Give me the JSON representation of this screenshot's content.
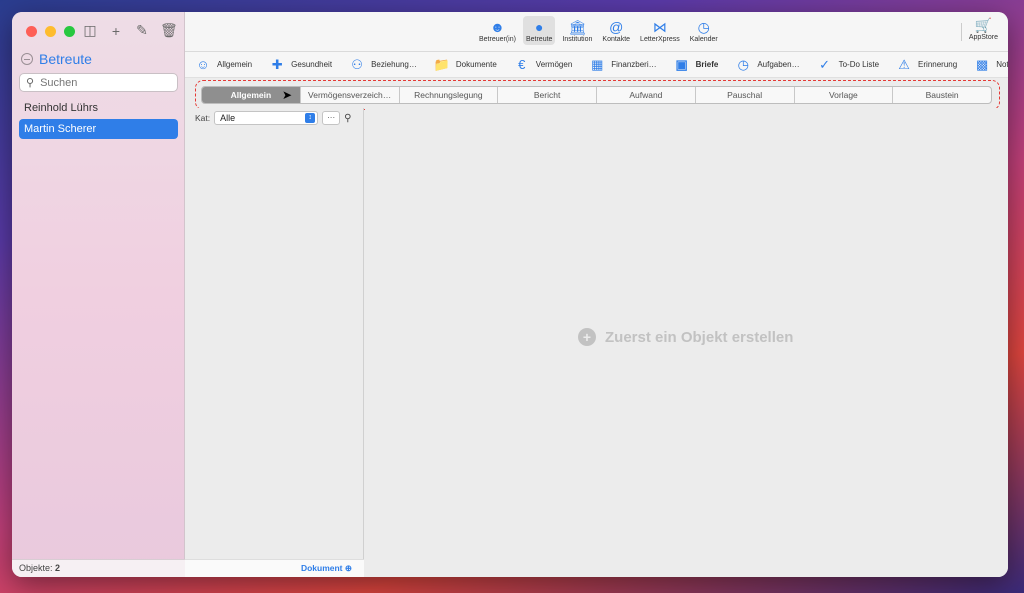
{
  "sidebar": {
    "section_title": "Betreute",
    "search_placeholder": "Suchen",
    "items": [
      {
        "label": "Reinhold Lührs"
      },
      {
        "label": "Martin Scherer"
      }
    ],
    "footer_label": "Objekte:",
    "footer_count": "2"
  },
  "toolbar": {
    "buttons": [
      {
        "label": "Betreuer(in)",
        "icon": "person-outline-icon"
      },
      {
        "label": "Betreute",
        "icon": "person-filled-icon"
      },
      {
        "label": "Institution",
        "icon": "bank-icon"
      },
      {
        "label": "Kontakte",
        "icon": "at-book-icon"
      },
      {
        "label": "LetterXpress",
        "icon": "letterxpress-icon"
      },
      {
        "label": "Kalender",
        "icon": "alarm-clock-icon"
      }
    ],
    "appstore_label": "AppStore"
  },
  "categories": [
    {
      "label": "Allgemein",
      "icon": "person-icon"
    },
    {
      "label": "Gesundheit",
      "icon": "medical-case-icon"
    },
    {
      "label": "Beziehung…",
      "icon": "people-icon"
    },
    {
      "label": "Dokumente",
      "icon": "folder-icon"
    },
    {
      "label": "Vermögen",
      "icon": "euro-icon"
    },
    {
      "label": "Finanzberi…",
      "icon": "chart-icon"
    },
    {
      "label": "Briefe",
      "icon": "document-icon"
    },
    {
      "label": "Aufgaben…",
      "icon": "task-icon"
    },
    {
      "label": "To-Do Liste",
      "icon": "checkmark-icon"
    },
    {
      "label": "Erinnerung",
      "icon": "bell-icon"
    },
    {
      "label": "Notiz",
      "icon": "note-icon"
    }
  ],
  "segments": [
    {
      "label": "Allgemein",
      "active": true
    },
    {
      "label": "Vermögensverzeich…",
      "active": false
    },
    {
      "label": "Rechnungslegung",
      "active": false
    },
    {
      "label": "Bericht",
      "active": false
    },
    {
      "label": "Aufwand",
      "active": false
    },
    {
      "label": "Pauschal",
      "active": false
    },
    {
      "label": "Vorlage",
      "active": false
    },
    {
      "label": "Baustein",
      "active": false
    }
  ],
  "filter": {
    "label": "Kat:",
    "value": "Alle",
    "more_label": "···"
  },
  "list_footer": {
    "button_label": "Dokument"
  },
  "detail": {
    "empty_message": "Zuerst ein Objekt erstellen"
  },
  "colors": {
    "accent": "#2f7ee8",
    "highlight_outline": "#e53935"
  }
}
